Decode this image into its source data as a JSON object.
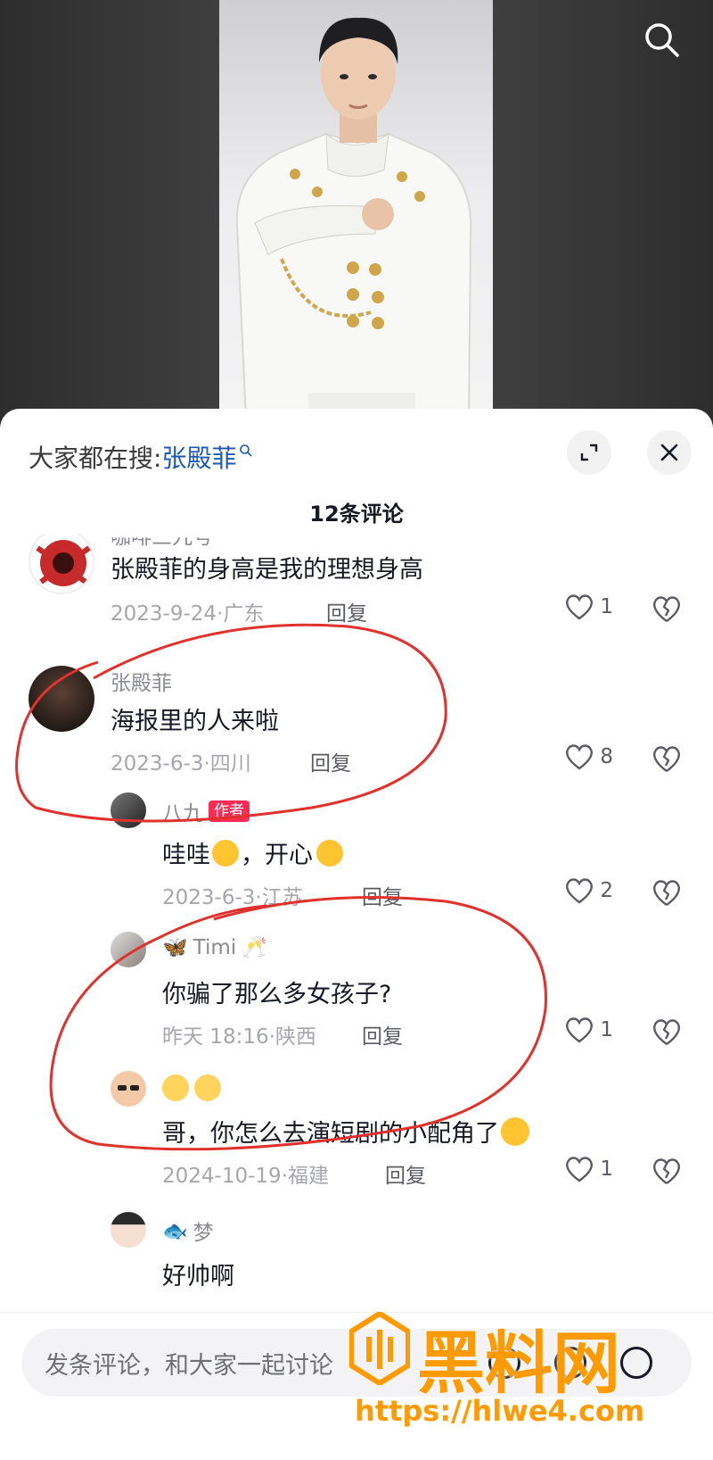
{
  "header": {
    "search_prefix": "大家都在搜:",
    "search_keyword": "张殿菲"
  },
  "comments_count_title": "12条评论",
  "comments": [
    {
      "name": "咖啡三九号",
      "text": "张殿菲的身高是我的理想身高",
      "meta": "2023-9-24·广东",
      "reply": "回复",
      "likes": "1"
    },
    {
      "name": "张殿菲",
      "text": "海报里的人来啦",
      "meta": "2023-6-3·四川",
      "reply": "回复",
      "likes": "8"
    },
    {
      "name": "八九",
      "badge": "作者",
      "text": "哇哇",
      "text_tail": "，开心",
      "meta": "2023-6-3·江苏",
      "reply": "回复",
      "likes": "2"
    },
    {
      "name": "Timi",
      "text": "你骗了那么多女孩子?",
      "meta": "昨天 18:16·陕西",
      "reply": "回复",
      "likes": "1"
    },
    {
      "name": "",
      "text": "哥，你怎么去演短剧的小配角了",
      "meta": "2024-10-19·福建",
      "reply": "回复",
      "likes": "1"
    },
    {
      "name": "梦",
      "text": "好帅啊"
    }
  ],
  "input": {
    "placeholder": "发条评论，和大家一起讨论"
  },
  "watermark": {
    "title": "黑料网",
    "url": "https://hlwe4.com"
  },
  "colors": {
    "keyword_blue": "#1b58b8",
    "author_badge": "#fe2c55",
    "annotation_red": "#e0322c",
    "watermark_orange": "#ff9a00"
  }
}
